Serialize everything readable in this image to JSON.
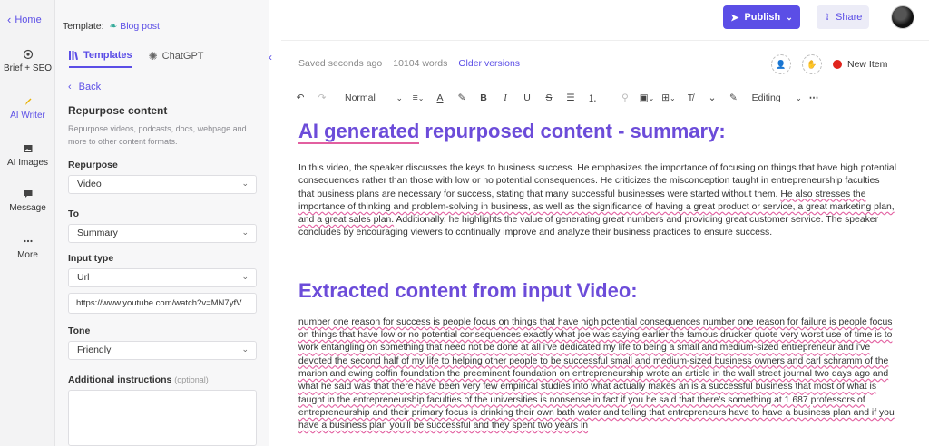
{
  "rail": {
    "home": "Home",
    "items": [
      {
        "label": "Brief + SEO",
        "icon": "target-icon"
      },
      {
        "label": "AI Writer",
        "icon": "pen-icon"
      },
      {
        "label": "AI Images",
        "icon": "image-icon"
      },
      {
        "label": "Message",
        "icon": "message-icon"
      },
      {
        "label": "More",
        "icon": "more-icon"
      }
    ]
  },
  "panel": {
    "template_label": "Template:",
    "template_name": "Blog post",
    "tabs": [
      "Templates",
      "ChatGPT"
    ],
    "back": "Back",
    "section_title": "Repurpose content",
    "section_desc": "Repurpose videos, podcasts, docs, webpage and more to other content formats.",
    "fields": {
      "repurpose_label": "Repurpose",
      "repurpose_value": "Video",
      "to_label": "To",
      "to_value": "Summary",
      "input_type_label": "Input type",
      "input_type_value": "Url",
      "url_value": "https://www.youtube.com/watch?v=MN7yfV",
      "tone_label": "Tone",
      "tone_value": "Friendly",
      "additional_label": "Additional instructions",
      "additional_optional": "(optional)"
    }
  },
  "topbar": {
    "publish": "Publish",
    "share": "Share"
  },
  "editor": {
    "saved": "Saved seconds ago",
    "words": "10104 words",
    "versions": "Older versions",
    "new_item": "New Item",
    "toolbar": {
      "style": "Normal",
      "mode": "Editing"
    },
    "heading1_a": "AI generated",
    "heading1_b": " repurposed content - summary:",
    "summary_a": "In this video, the speaker discusses the keys to business success. He emphasizes the importance of focusing on things that have high potential consequences rather than those with low or no potential consequences. He criticizes the misconception taught in entrepreneurship faculties that business plans are necessary for success, stating that many successful businesses were started without them. ",
    "summary_b": "He also stresses the importance of thinking and problem-solving in business, as well as the significance of having a great product or service, a great marketing plan, and a great sales plan.",
    "summary_c": " Additionally, he highlights the value of generating great numbers and providing great customer service. The speaker concludes by encouraging viewers to continually improve and analyze their business practices to ensure success.",
    "heading2": "Extracted content from input  Video:",
    "extracted": "number one reason for success is people focus on things that have high potential consequences number one reason for failure is people focus on things that have low or no potential consequences exactly what joe was saying earlier the famous drucker quote very worst use of time is to work entangling on something that need not be done at all i've dedicated my life to being a small and medium-sized entrepreneur and i've devoted the second half of my life to helping other people to be successful small and medium-sized business owners and carl schramm of the marion and ewing coffin foundation the preeminent foundation on entrepreneurship wrote an article in the wall street journal two days ago and what he said was that there have been very few empirical studies into what actually makes an is a successful business that most of what is taught in the entrepreneurship faculties of the universities is nonsense in fact if you he said that there's something at 1 687 professors of entrepreneurship and their primary focus is drinking their own bath water and telling that entrepreneurs have to have a business plan and if you have a business plan you'll be successful and they spent two years in"
  },
  "colors": {
    "accent": "#5b4ee6",
    "heading": "#6c4cd9",
    "status_dot": "#e0241c"
  }
}
